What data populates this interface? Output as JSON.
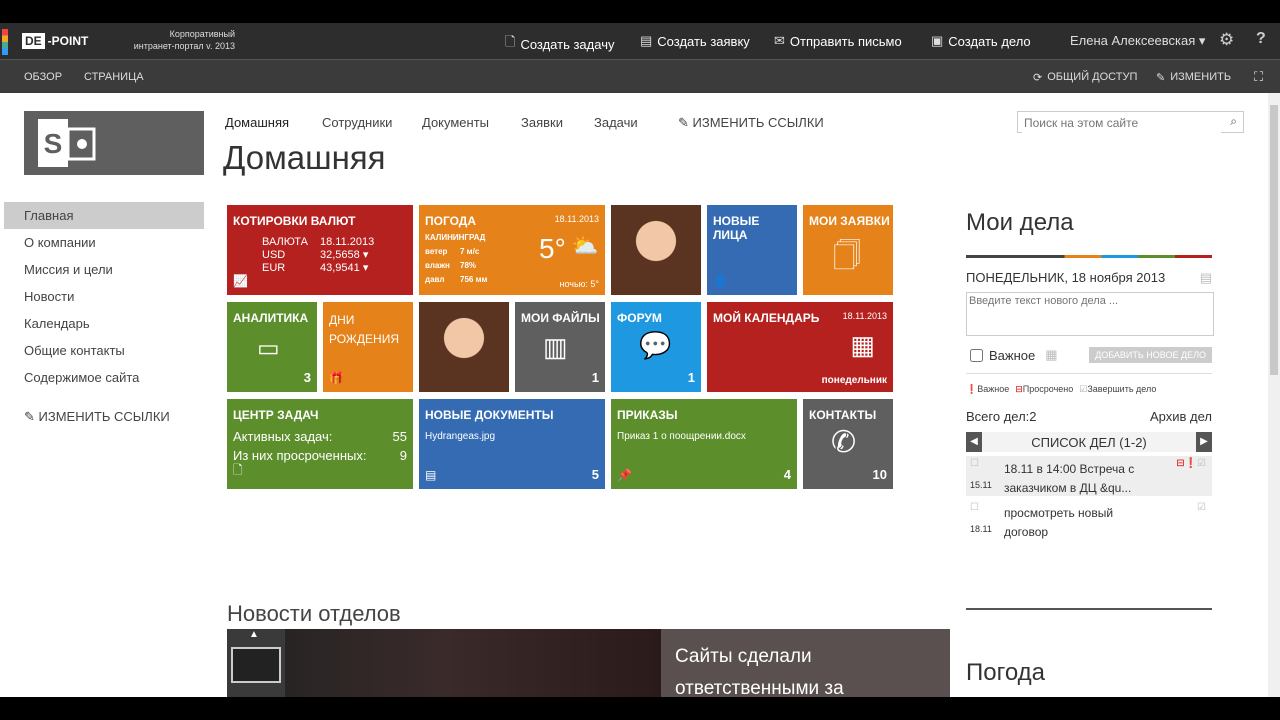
{
  "suite": {
    "logo_de": "DE",
    "logo_point": "-POINT",
    "corp_line1": "Корпоративный",
    "corp_line2": "интранет-портал v. 2013",
    "actions": [
      "Создать задачу",
      "Создать заявку",
      "Отправить письмо",
      "Создать дело"
    ],
    "user": "Елена Алексеевская",
    "help": "?"
  },
  "ribbon": {
    "tabs": [
      "ОБЗОР",
      "СТРАНИЦА"
    ],
    "share": "ОБЩИЙ ДОСТУП",
    "edit": "ИЗМЕНИТЬ"
  },
  "topnav": [
    "Домашняя",
    "Сотрудники",
    "Документы",
    "Заявки",
    "Задачи"
  ],
  "edit_links": "ИЗМЕНИТЬ ССЫЛКИ",
  "page_title": "Домашняя",
  "search": {
    "placeholder": "Поиск на этом сайте"
  },
  "leftnav": [
    "Главная",
    "О компании",
    "Миссия и цели",
    "Новости",
    "Календарь",
    "Общие контакты",
    "Содержимое сайта"
  ],
  "tiles": {
    "currency": {
      "title": "КОТИРОВКИ ВАЛЮТ",
      "h1": "ВАЛЮТА",
      "h2": "18.11.2013",
      "r1n": "USD",
      "r1v": "32,5658",
      "r2n": "EUR",
      "r2v": "43,9541"
    },
    "weather": {
      "title": "ПОГОДА",
      "date": "18.11.2013",
      "city": "КАЛИНИНГРАД",
      "wind_l": "ветер",
      "wind_v": "7 м/с",
      "hum_l": "влажн",
      "hum_v": "78%",
      "press_l": "давл",
      "press_v": "756 мм",
      "temp": "5°",
      "night": "ночью: 5°"
    },
    "new_faces": {
      "title": "НОВЫЕ ЛИЦА"
    },
    "my_requests": {
      "title": "МОИ ЗАЯВКИ"
    },
    "analytics": {
      "title": "АНАЛИТИКА",
      "count": "3"
    },
    "birthdays": {
      "title1": "ДНИ",
      "title2": "РОЖДЕНИЯ"
    },
    "my_files": {
      "title": "МОИ ФАЙЛЫ",
      "count": "1"
    },
    "forum": {
      "title": "ФОРУМ",
      "count": "1"
    },
    "calendar": {
      "title": "МОЙ КАЛЕНДАРЬ",
      "date": "18.11.2013",
      "day": "понедельник"
    },
    "tasks": {
      "title": "ЦЕНТР ЗАДАЧ",
      "l1": "Активных задач:",
      "v1": "55",
      "l2": "Из них просроченных:",
      "v2": "9"
    },
    "new_docs": {
      "title": "НОВЫЕ ДОКУМЕНТЫ",
      "file": "Hydrangeas.jpg",
      "count": "5"
    },
    "orders": {
      "title": "ПРИКАЗЫ",
      "file": "Приказ 1 о поощрении.docx",
      "count": "4"
    },
    "contacts": {
      "title": "КОНТАКТЫ",
      "count": "10"
    }
  },
  "news": {
    "title": "Новости отделов",
    "headline1": "Сайты сделали",
    "headline2": "ответственными за"
  },
  "mydeals": {
    "title": "Мои дела",
    "date": "ПОНЕДЕЛЬНИК, 18 ноября 2013",
    "placeholder": "Введите текст нового дела ...",
    "important": "Важное",
    "add_button": "ДОБАВИТЬ НОВОЕ ДЕЛО",
    "legend": [
      "Важное",
      "Просрочено",
      "Завершить дело"
    ],
    "total": "Всего дел:2",
    "archive": "Архив дел",
    "list_title": "СПИСОК ДЕЛ (1-2)",
    "items": [
      {
        "date": "15.11",
        "text1": "18.11 в 14:00 Встреча с",
        "text2": "заказчиком в ДЦ &qu..."
      },
      {
        "date": "18.11",
        "text1": "просмотреть новый",
        "text2": "договор"
      }
    ]
  },
  "weather_section": {
    "title": "Погода"
  },
  "colors": {
    "red": "#b5211f",
    "orange": "#e5821a",
    "blue": "#356bb3",
    "green": "#5c8e2c",
    "gray": "#5f5f5f",
    "sky": "#1e98e0"
  }
}
